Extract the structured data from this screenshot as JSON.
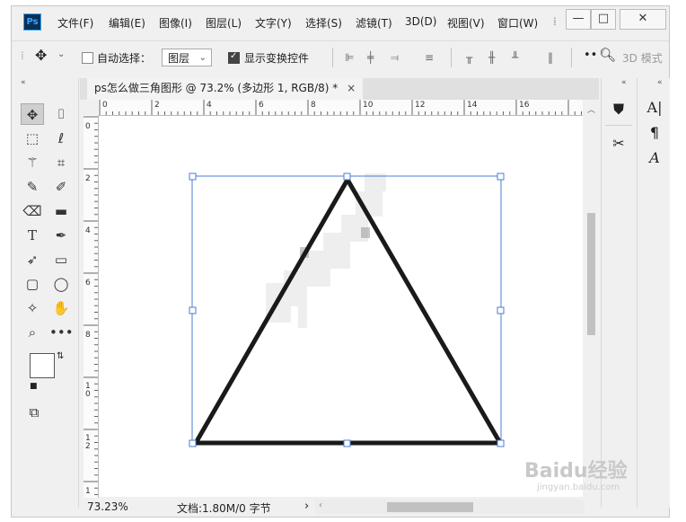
{
  "app": {
    "logo": "Ps"
  },
  "menu": [
    "文件(F)",
    "编辑(E)",
    "图像(I)",
    "图层(L)",
    "文字(Y)",
    "选择(S)",
    "滤镜(T)",
    "3D(D)",
    "视图(V)",
    "窗口(W)"
  ],
  "window_controls": {
    "minimize": "—",
    "maximize": "□",
    "close": "✕"
  },
  "options": {
    "move_icon": "move-icon",
    "auto_select_label": "自动选择：",
    "auto_select_checked": false,
    "layer_select": "图层",
    "show_transform_label": "显示变换控件",
    "show_transform_checked": true,
    "mode_3d_label": "3D 模式"
  },
  "document": {
    "tab_title": "ps怎么做三角图形 @ 73.2% (多边形 1, RGB/8) *",
    "close": "×"
  },
  "ruler": {
    "h_labels": [
      "0",
      "2",
      "4",
      "6",
      "8",
      "10",
      "12",
      "14",
      "16"
    ],
    "v_labels": [
      "0",
      "2",
      "4",
      "6",
      "8",
      "1 0",
      "1 2",
      "1"
    ]
  },
  "status": {
    "zoom": "73.23%",
    "doc_info": "文档:1.80M/0 字节",
    "arrow": "›"
  },
  "watermark": {
    "brand": "Baidu经验",
    "url": "jingyan.baidu.com"
  },
  "colors": {
    "selection": "#4a7bd4",
    "triangle_stroke": "#1a1a1a"
  }
}
